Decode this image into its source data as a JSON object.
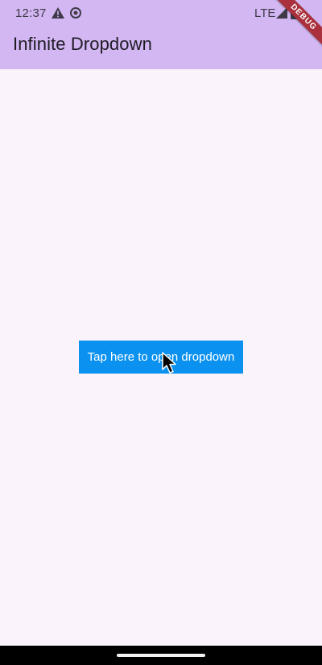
{
  "status_bar": {
    "time": "12:37",
    "network": "LTE",
    "icons": [
      "alert-icon",
      "circle-icon",
      "signal-icon",
      "battery-icon"
    ]
  },
  "app_bar": {
    "title": "Infinite Dropdown",
    "background": "#d2b7f2"
  },
  "debug_banner": {
    "label": "DEBUG",
    "color": "#a9303c"
  },
  "main": {
    "button_label": "Tap here to open dropdown",
    "button_color": "#0b91f0",
    "background": "#fbf3fb"
  },
  "nav_bar": {
    "icons": [
      "home-handle"
    ]
  }
}
